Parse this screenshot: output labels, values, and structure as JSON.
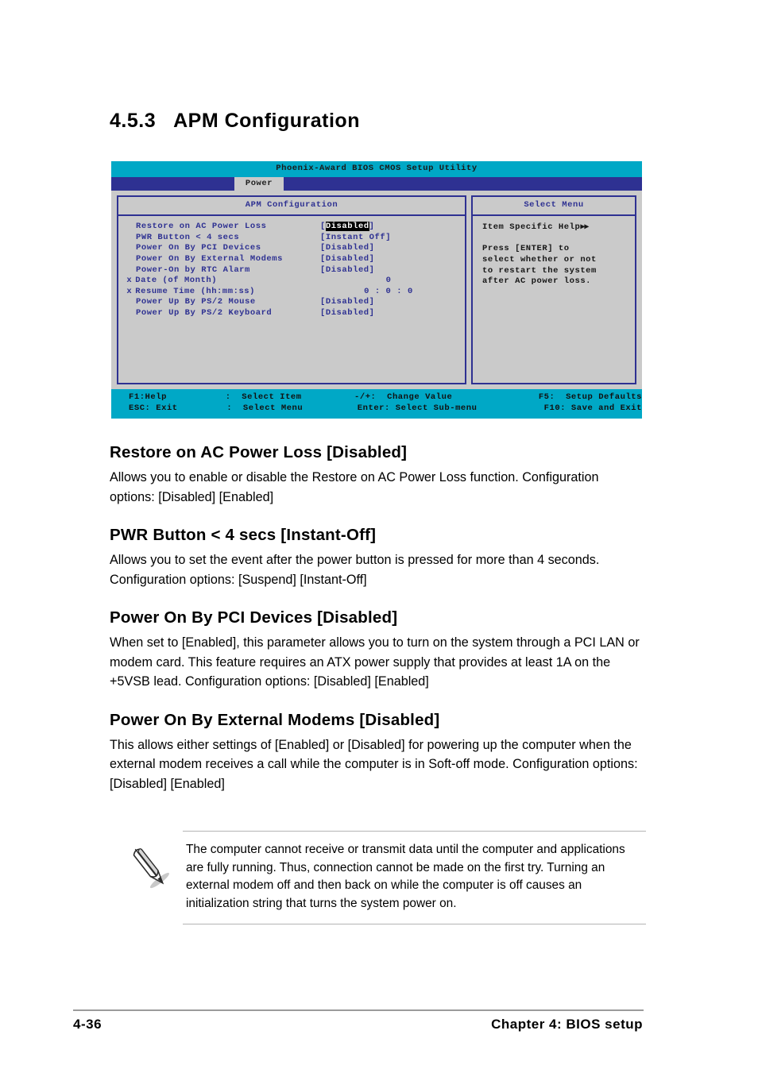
{
  "section": {
    "number": "4.5.3",
    "title": "APM Configuration"
  },
  "bios": {
    "title": "Phoenix-Award BIOS CMOS Setup Utility",
    "active_tab": "Power",
    "left_panel_title": "APM Configuration",
    "right_panel_title": "Select Menu",
    "help": {
      "head": "Item Specific Help",
      "head_arrows": "▶▶",
      "lines": [
        "Press [ENTER] to",
        "select whether or not",
        "to restart the system",
        "after AC power loss."
      ]
    },
    "options": [
      {
        "mark": "",
        "label": "Restore on AC Power Loss",
        "value": "[Disabled]",
        "highlighted": true,
        "center": false
      },
      {
        "mark": "",
        "label": "PWR Button < 4 secs",
        "value": "[Instant Off]",
        "highlighted": false,
        "center": false
      },
      {
        "mark": "",
        "label": "Power On By PCI Devices",
        "value": "[Disabled]",
        "highlighted": false,
        "center": false
      },
      {
        "mark": "",
        "label": "Power On By External Modems",
        "value": "[Disabled]",
        "highlighted": false,
        "center": false
      },
      {
        "mark": "",
        "label": "Power-On by RTC Alarm",
        "value": "[Disabled]",
        "highlighted": false,
        "center": false
      },
      {
        "mark": "x",
        "label": "Date (of Month)",
        "value": "0",
        "highlighted": false,
        "center": true
      },
      {
        "mark": "x",
        "label": "Resume Time (hh:mm:ss)",
        "value": "0 : 0 : 0",
        "highlighted": false,
        "center": true
      },
      {
        "mark": "",
        "label": "Power Up By PS/2 Mouse",
        "value": "[Disabled]",
        "highlighted": false,
        "center": false
      },
      {
        "mark": "",
        "label": "Power Up By PS/2 Keyboard",
        "value": "[Disabled]",
        "highlighted": false,
        "center": false
      }
    ],
    "footer": {
      "row1": {
        "c1": "F1:Help",
        "c2": ":  Select Item",
        "c3": "-/+:  Change Value",
        "c4": "F5:  Setup Defaults"
      },
      "row2": {
        "c1": "ESC: Exit",
        "c2": ":  Select Menu",
        "c3": "Enter: Select Sub-menu",
        "c4": "F10: Save and Exit"
      }
    },
    "colors": {
      "title_bar": "#00a8c6",
      "tab_bar": "#2e3192",
      "panel_bg": "#cacaca",
      "panel_border": "#2e3192",
      "text_blue": "#2e3192",
      "highlight_bg": "#000000",
      "highlight_fg": "#ffffff"
    }
  },
  "doc_sections": [
    {
      "heading": "Restore on AC Power Loss [Disabled]",
      "body": "Allows you to enable or disable the Restore on AC Power Loss function. Configuration options: [Disabled] [Enabled]"
    },
    {
      "heading": "PWR Button < 4 secs [Instant-Off]",
      "body": "Allows you to set the event after the power button is pressed for more than 4 seconds. Configuration options: [Suspend] [Instant-Off]"
    },
    {
      "heading": "Power On By PCI Devices [Disabled]",
      "body": "When set to [Enabled], this parameter allows you to turn on the system through a PCI LAN or modem card. This feature requires an ATX power supply that provides at least 1A on the +5VSB lead. Configuration options: [Disabled] [Enabled]"
    },
    {
      "heading": "Power On By External Modems [Disabled]",
      "body": "This allows either settings of [Enabled] or [Disabled] for powering up the computer when the external modem receives a call while the computer is in Soft-off mode. Configuration options: [Disabled] [Enabled]"
    }
  ],
  "note": {
    "icon": "pencil-note-icon",
    "text": "The computer cannot receive or transmit data until the computer and applications are fully running. Thus, connection cannot be made on the first try. Turning an external modem off and then back on while the computer is off causes an initialization string that turns the system power on."
  },
  "page_footer": {
    "page_number": "4-36",
    "chapter": "Chapter 4: BIOS setup"
  }
}
